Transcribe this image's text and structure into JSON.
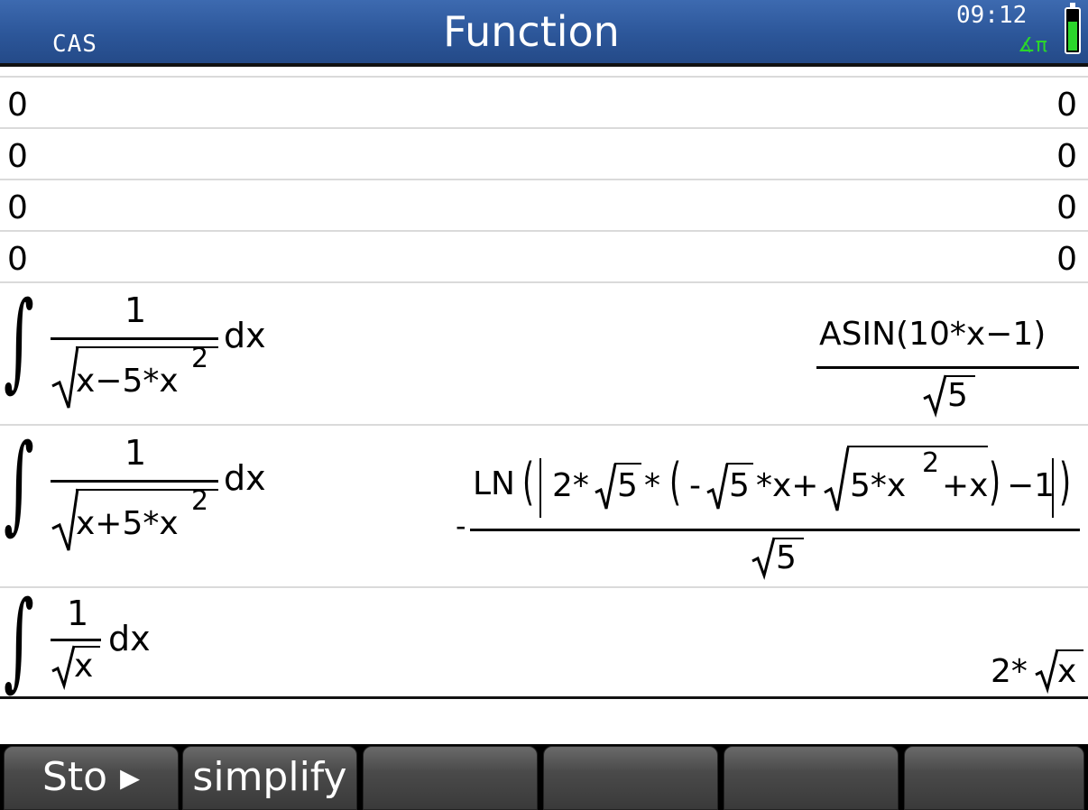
{
  "titlebar": {
    "mode": "CAS",
    "title": "Function",
    "clock": "09:12",
    "angle_indicator": "∡π",
    "battery_icon": "battery-icon",
    "battery_level_fraction": 0.7,
    "accent_color": "#2c5699",
    "indicator_color": "#2bd62b"
  },
  "history": {
    "simple_rows": [
      {
        "input": "0",
        "output": "0"
      },
      {
        "input": "0",
        "output": "0"
      },
      {
        "input": "0",
        "output": "0"
      },
      {
        "input": "0",
        "output": "0"
      }
    ],
    "row5": {
      "numerator": "1",
      "radicand": "x−5*x",
      "exponent": "2",
      "differential": "dx",
      "result_numerator": "ASIN(10*x−1)",
      "result_radicand": "5"
    },
    "row6": {
      "numerator": "1",
      "radicand": "x+5*x",
      "exponent": "2",
      "differential": "dx",
      "result_sign": "-",
      "result_ln": "LN",
      "result_part1": "2*",
      "result_sqrt5": "5",
      "result_part2": "*",
      "result_neg": "-",
      "result_sqrt5b": "5",
      "result_part3": "*x+",
      "result_inner_radicand": "5*x",
      "result_inner_exponent": "2",
      "result_inner_tail": "+x",
      "result_part4": "−1",
      "result_denominator_radicand": "5"
    },
    "row7": {
      "numerator": "1",
      "radicand": "x",
      "differential": "dx",
      "result_coeff": "2*",
      "result_radicand": "x"
    }
  },
  "menu": {
    "keys": [
      "Sto ▸",
      "simplify",
      "",
      "",
      "",
      ""
    ]
  }
}
